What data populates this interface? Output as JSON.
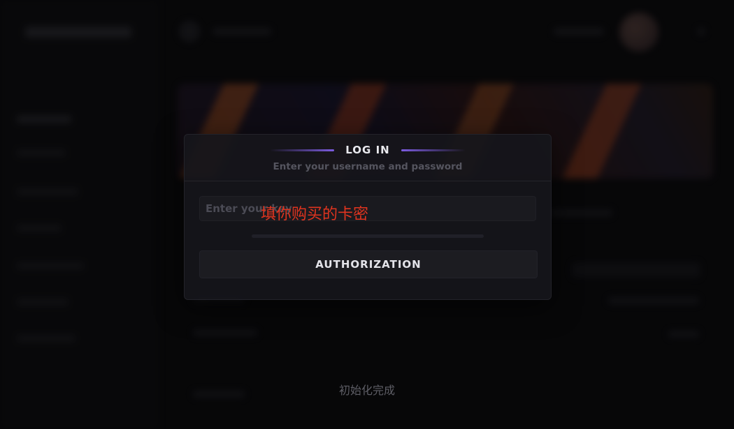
{
  "modal": {
    "title": "LOG IN",
    "subtitle": "Enter your username and password",
    "key_input": {
      "placeholder": "Enter your key",
      "value": ""
    },
    "progress": 0,
    "authorize_label": "AUTHORIZATION"
  },
  "annotation": {
    "text": "填你购买的卡密",
    "color": "#e0341f"
  },
  "status": {
    "text": "初始化完成"
  },
  "colors": {
    "accent": "#7c5ce0",
    "background": "#0b0b0d",
    "modal_bg": "#16161b"
  },
  "icons": {
    "topbar_circle": "app-icon",
    "avatar": "avatar"
  }
}
